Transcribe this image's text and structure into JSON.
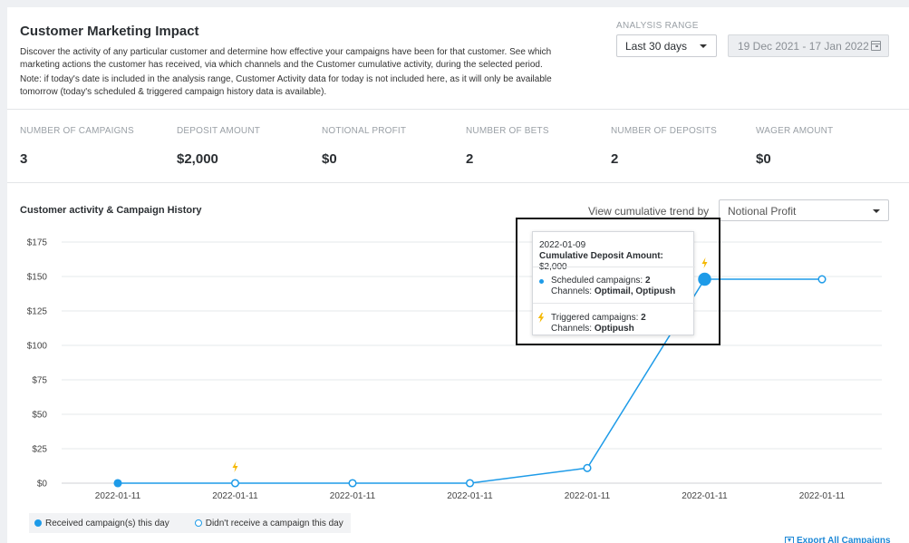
{
  "header": {
    "title": "Customer Marketing Impact",
    "description": "Discover the activity of any particular customer and determine how effective your campaigns have been for that customer. See which marketing actions the customer has received, via which channels and the Customer cumulative activity, during the selected period.",
    "note": "Note: if today's date is included in the analysis range, Customer Activity data for today is not included here, as it will only be available tomorrow (today's scheduled & triggered campaign history data is available).",
    "range_label": "ANALYSIS RANGE",
    "range_value": "Last 30 days",
    "date_range": "19 Dec 2021 - 17 Jan 2022"
  },
  "metrics": [
    {
      "label": "NUMBER OF CAMPAIGNS",
      "value": "3"
    },
    {
      "label": "DEPOSIT AMOUNT",
      "value": "$2,000"
    },
    {
      "label": "NOTIONAL PROFIT",
      "value": "$0"
    },
    {
      "label": "NUMBER OF BETS",
      "value": "2"
    },
    {
      "label": "NUMBER OF DEPOSITS",
      "value": "2"
    },
    {
      "label": "WAGER AMOUNT",
      "value": "$0"
    }
  ],
  "chart_section": {
    "title": "Customer activity & Campaign History",
    "trend_label": "View cumulative trend by",
    "trend_value": "Notional Profit"
  },
  "tooltip": {
    "date": "2022-01-09",
    "cumulative_label": "Cumulative Deposit Amount:",
    "cumulative_value": "$2,000",
    "scheduled_label": "Scheduled campaigns:",
    "scheduled_value": "2",
    "scheduled_channels_label": "Channels:",
    "scheduled_channels_value": "Optimail, Optipush",
    "triggered_label": "Triggered campaigns:",
    "triggered_value": "2",
    "triggered_channels_label": "Channels:",
    "triggered_channels_value": "Optipush"
  },
  "legend": {
    "received": "Received campaign(s) this day",
    "not_received": "Didn't receive a campaign this day"
  },
  "export_label": "Export All Campaigns",
  "colors": {
    "line": "#1e9be8",
    "grid": "#e6e8eb",
    "triggered": "#f5b800"
  },
  "chart_data": {
    "type": "line",
    "x": [
      "2022-01-11",
      "2022-01-11",
      "2022-01-11",
      "2022-01-11",
      "2022-01-11",
      "2022-01-11",
      "2022-01-11"
    ],
    "yticks": [
      "$0",
      "$25",
      "$50",
      "$75",
      "$100",
      "$125",
      "$150",
      "$175"
    ],
    "ylim": [
      0,
      175
    ],
    "series": [
      {
        "values": [
          0,
          0,
          0,
          0,
          11,
          148,
          148
        ],
        "received": [
          true,
          false,
          false,
          false,
          false,
          true,
          false
        ],
        "triggered": [
          false,
          true,
          false,
          false,
          false,
          true,
          false
        ],
        "highlighted": [
          false,
          false,
          false,
          false,
          false,
          true,
          false
        ]
      }
    ],
    "grid": true,
    "legend": "bottom-left"
  }
}
